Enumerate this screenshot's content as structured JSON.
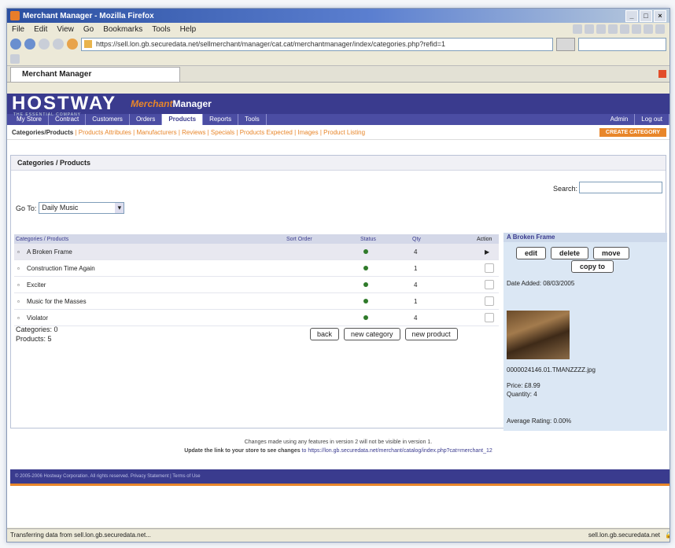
{
  "window": {
    "title": "Merchant Manager - Mozilla Firefox"
  },
  "menu": [
    "File",
    "Edit",
    "View",
    "Go",
    "Bookmarks",
    "Tools",
    "Help"
  ],
  "address": {
    "url": "https://sell.lon.gb.securedata.net/sellmerchant/manager/cat.cat/merchantmanager/index/categories.php?refid=1"
  },
  "tab": {
    "label": "Merchant Manager"
  },
  "site": {
    "logo": "HOSTWAY",
    "tagline": "THE ESSENTIAL COMPANY",
    "product_a": "Merchant",
    "product_b": "Manager",
    "nav": [
      "My Store",
      "Contract",
      "Customers",
      "Orders",
      "Products",
      "Reports",
      "Tools"
    ],
    "nav_active": "Products",
    "nav_right": [
      "Admin",
      "Log out"
    ],
    "subnav_first": "Categories/Products",
    "subnav": [
      "Products Attributes",
      "Manufacturers",
      "Reviews",
      "Specials",
      "Products Expected",
      "Images",
      "Product Listing"
    ],
    "subnav_button": "CREATE CATEGORY"
  },
  "main": {
    "title": "Categories / Products",
    "search_label": "Search:",
    "goto_label": "Go To:",
    "goto_value": "Daily Music",
    "columns": [
      "Categories / Products",
      "Sort Order",
      "Status",
      "Qty",
      "Action"
    ],
    "rows": [
      {
        "name": "A Broken Frame",
        "qty": "4"
      },
      {
        "name": "Construction Time Again",
        "qty": "1"
      },
      {
        "name": "Exciter",
        "qty": "4"
      },
      {
        "name": "Music for the Masses",
        "qty": "1"
      },
      {
        "name": "Violator",
        "qty": "4"
      }
    ],
    "categories_count": "Categories: 0",
    "products_count": "Products: 5",
    "buttons": {
      "back": "back",
      "new_category": "new category",
      "new_product": "new product"
    }
  },
  "side": {
    "title": "A Broken Frame",
    "edit": "edit",
    "delete": "delete",
    "move": "move",
    "copy": "copy to",
    "date_added": "Date Added: 08/03/2005",
    "image_name": "0000024146.01.TMANZZZZ.jpg",
    "price": "Price: £8.99",
    "quantity": "Quantity: 4",
    "rating": "Average Rating: 0.00%"
  },
  "notice": {
    "line1": "Changes made using any features in version 2 will not be visible in version 1.",
    "line2_bold": "Update the link to your store to see changes",
    "line2_rest": " to https://lon.gb.securedata.net/merchant/catalog/index.php?cat=merchant_12"
  },
  "footer": "© 2005-2006 Hostway Corporation. All rights reserved. Privacy Statement | Terms of Use",
  "status": {
    "left": "Transferring data from sell.lon.gb.securedata.net...",
    "right": "sell.lon.gb.securedata.net"
  }
}
